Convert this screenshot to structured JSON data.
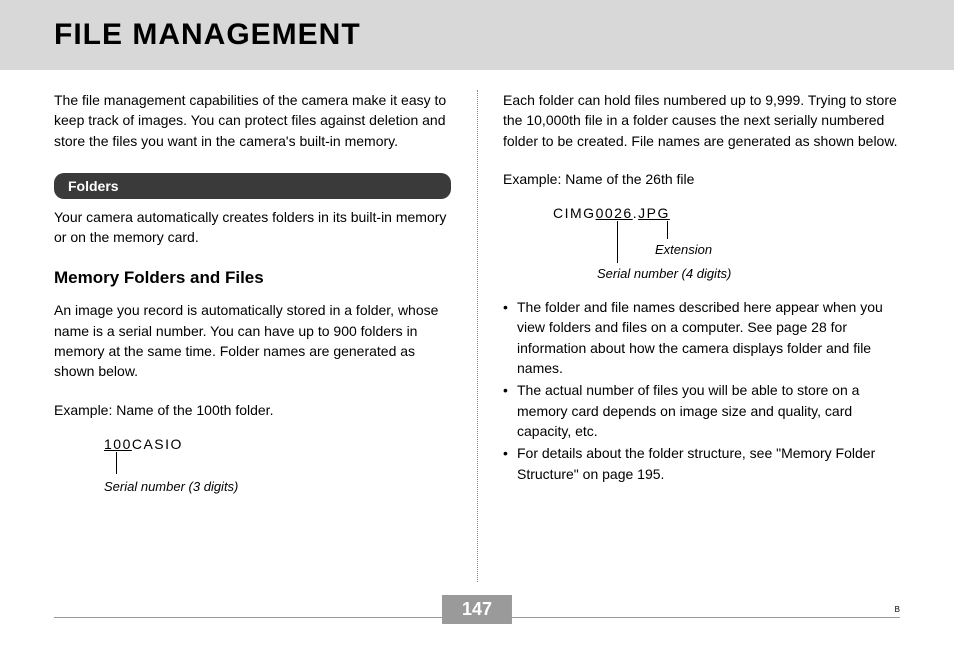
{
  "title": "FILE MANAGEMENT",
  "left": {
    "intro": "The file management capabilities of the camera make it easy to keep track of images. You can protect files against deletion and store the files you want in the camera's built-in memory.",
    "section_label": "Folders",
    "folders_text": "Your camera automatically creates folders in its built-in memory or on the memory card.",
    "subhead": "Memory Folders and Files",
    "subhead_text": "An image you record is automatically stored in a folder, whose name is a serial number. You can have up to 900 folders in memory at the same time. Folder names are generated as shown below.",
    "example1_label": "Example: Name of the 100th folder.",
    "diagram1": {
      "serial": "100",
      "suffix": "CASIO",
      "annotation": "Serial number (3 digits)"
    }
  },
  "right": {
    "intro": "Each folder can hold files numbered up to 9,999. Trying to store the 10,000th file in a folder causes the next serially numbered folder to be created. File names are generated as shown below.",
    "example2_label": "Example: Name of the 26th file",
    "diagram2": {
      "prefix": "CIMG",
      "serial": "0026",
      "dot": ".",
      "ext": "JPG",
      "annotation_serial": "Serial number (4 digits)",
      "annotation_ext": "Extension"
    },
    "bullets": [
      "The folder and file names described here appear when you view folders and files on a computer. See page 28 for information about how the camera displays folder and file names.",
      "The actual number of files you will be able to store on a memory card depends on image size and quality, card capacity, etc.",
      "For details about the folder structure, see \"Memory Folder Structure\" on page 195."
    ]
  },
  "page_number": "147",
  "footer_mark": "B"
}
